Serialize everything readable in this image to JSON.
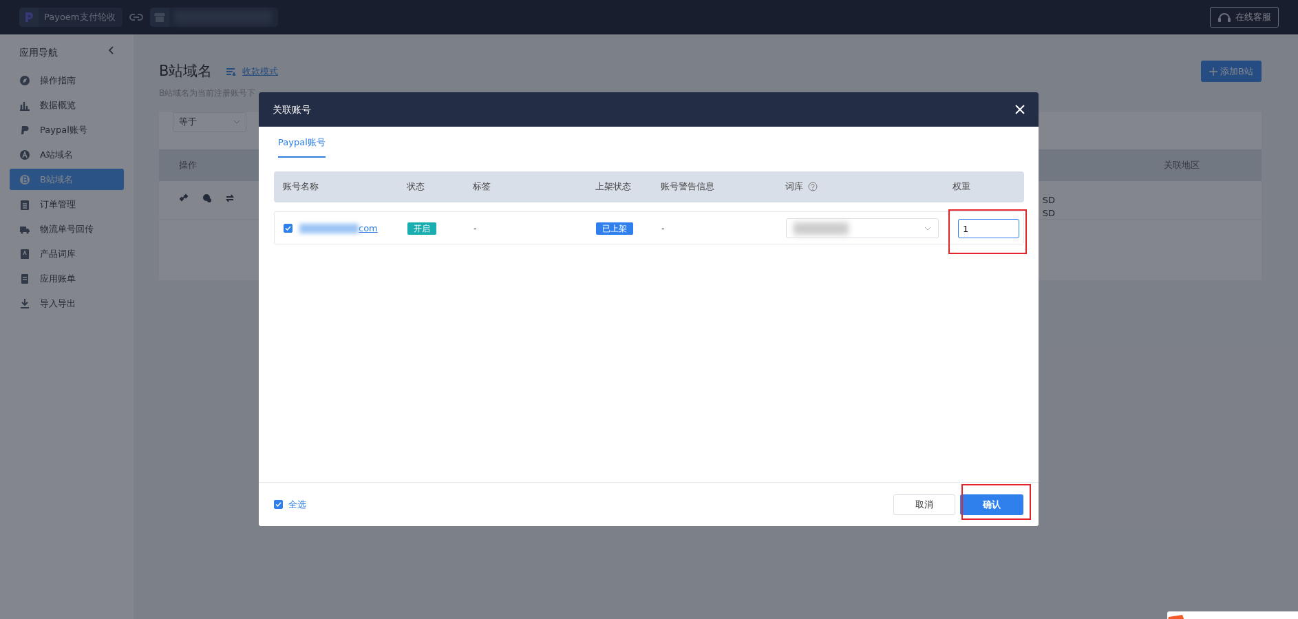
{
  "topbar": {
    "brand": "Payoem支付轮收",
    "support_button": "在线客服"
  },
  "sidebar": {
    "title": "应用导航",
    "items": [
      {
        "label": "操作指南",
        "selected": false
      },
      {
        "label": "数据概览",
        "selected": false
      },
      {
        "label": "Paypal账号",
        "selected": false
      },
      {
        "label": "A站域名",
        "selected": false
      },
      {
        "label": "B站域名",
        "selected": true
      },
      {
        "label": "订单管理",
        "selected": false
      },
      {
        "label": "物流单号回传",
        "selected": false
      },
      {
        "label": "产品词库",
        "selected": false
      },
      {
        "label": "应用账单",
        "selected": false
      },
      {
        "label": "导入导出",
        "selected": false
      }
    ]
  },
  "page": {
    "title": "B站域名",
    "mode_link": "收款模式",
    "description": "B站域名为当前注册账号下",
    "add_button": "添加B站",
    "filter_select": "等于",
    "table": {
      "columns": [
        "操作",
        "关联地区"
      ],
      "cells": [
        "SD",
        "SD"
      ]
    }
  },
  "modal": {
    "title": "关联账号",
    "tabs": [
      {
        "label": "Paypal账号",
        "selected": true
      }
    ],
    "table": {
      "columns": [
        "账号名称",
        "状态",
        "标签",
        "上架状态",
        "账号警告信息",
        "词库",
        "权重"
      ],
      "rows": [
        {
          "checked": true,
          "account": "com",
          "status": "开启",
          "tag": "-",
          "listing": "已上架",
          "warning": "-",
          "weight": "1"
        }
      ]
    },
    "select_all": {
      "label": "全选",
      "checked": true
    },
    "buttons": [
      {
        "label": "取消",
        "kind": "secondary"
      },
      {
        "label": "确认",
        "kind": "primary"
      }
    ]
  }
}
